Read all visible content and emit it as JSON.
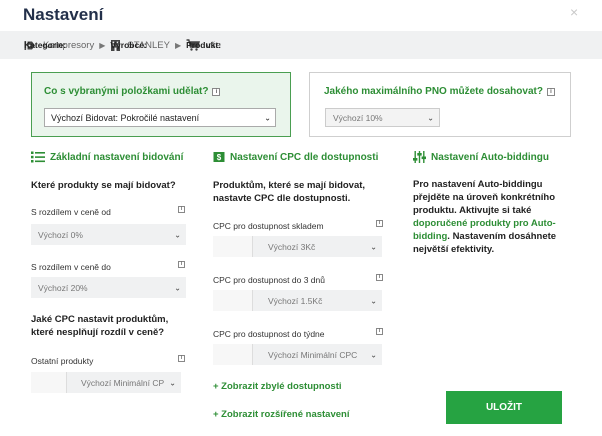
{
  "dialog": {
    "title": "Nastavení",
    "close_glyph": "×"
  },
  "breadcrumb": [
    {
      "label": "Kategorie:",
      "value": "Kompresory",
      "icon": "tag-icon"
    },
    {
      "label": "Výrobce:",
      "value": "STANLEY",
      "icon": "building-icon"
    },
    {
      "label": "Produkt:",
      "value": "vše",
      "icon": "cart-icon"
    }
  ],
  "bid_box": {
    "question": "Co s vybranými položkami udělat?",
    "selected": "Výchozí Bidovat: Pokročilé nastavení"
  },
  "pno_box": {
    "question": "Jakého maximálního PNO můžete dosahovat?",
    "selected": "Výchozí 10%"
  },
  "basic": {
    "heading": "Základní nastavení bidování",
    "question1": "Které produkty se mají bidovat?",
    "field1_label": "S rozdílem v ceně od",
    "field1_value": "Výchozí 0%",
    "field2_label": "S rozdílem v ceně do",
    "field2_value": "Výchozí 20%",
    "question2": "Jaké CPC nastavit produktům, které nesplňují rozdíl v ceně?",
    "field3_label": "Ostatní produkty",
    "field3_value": "Výchozí Minimální CP"
  },
  "cpc": {
    "heading": "Nastavení CPC dle dostupnosti",
    "intro": "Produktům, které se mají bidovat, nastavte CPC dle dostupnosti.",
    "field1_label": "CPC pro dostupnost skladem",
    "field1_value": "Výchozí 3Kč",
    "field2_label": "CPC pro dostupnost do 3 dnů",
    "field2_value": "Výchozí 1.5Kč",
    "field3_label": "CPC pro dostupnost do týdne",
    "field3_value": "Výchozí Minimální CPC",
    "link1": "+ Zobrazit zbylé dostupnosti",
    "link2": "+ Zobrazit rozšířené nastavení"
  },
  "auto": {
    "heading": "Nastavení Auto-biddingu",
    "text1": "Pro nastavení Auto-biddingu přejděte na úroveň konkrétního produktu. Aktivujte si také ",
    "link": "doporučené produkty pro Auto-bidding",
    "text2": ". Nastavením dosáhnete největší efektivity."
  },
  "confirm_button": "ULOŽIT",
  "colors": {
    "accent": "#2d8e35",
    "button": "#26a342",
    "title": "#23304a",
    "breadcrumb_bg": "#f0f1f2",
    "panel_bg": "#eaf5ec"
  }
}
